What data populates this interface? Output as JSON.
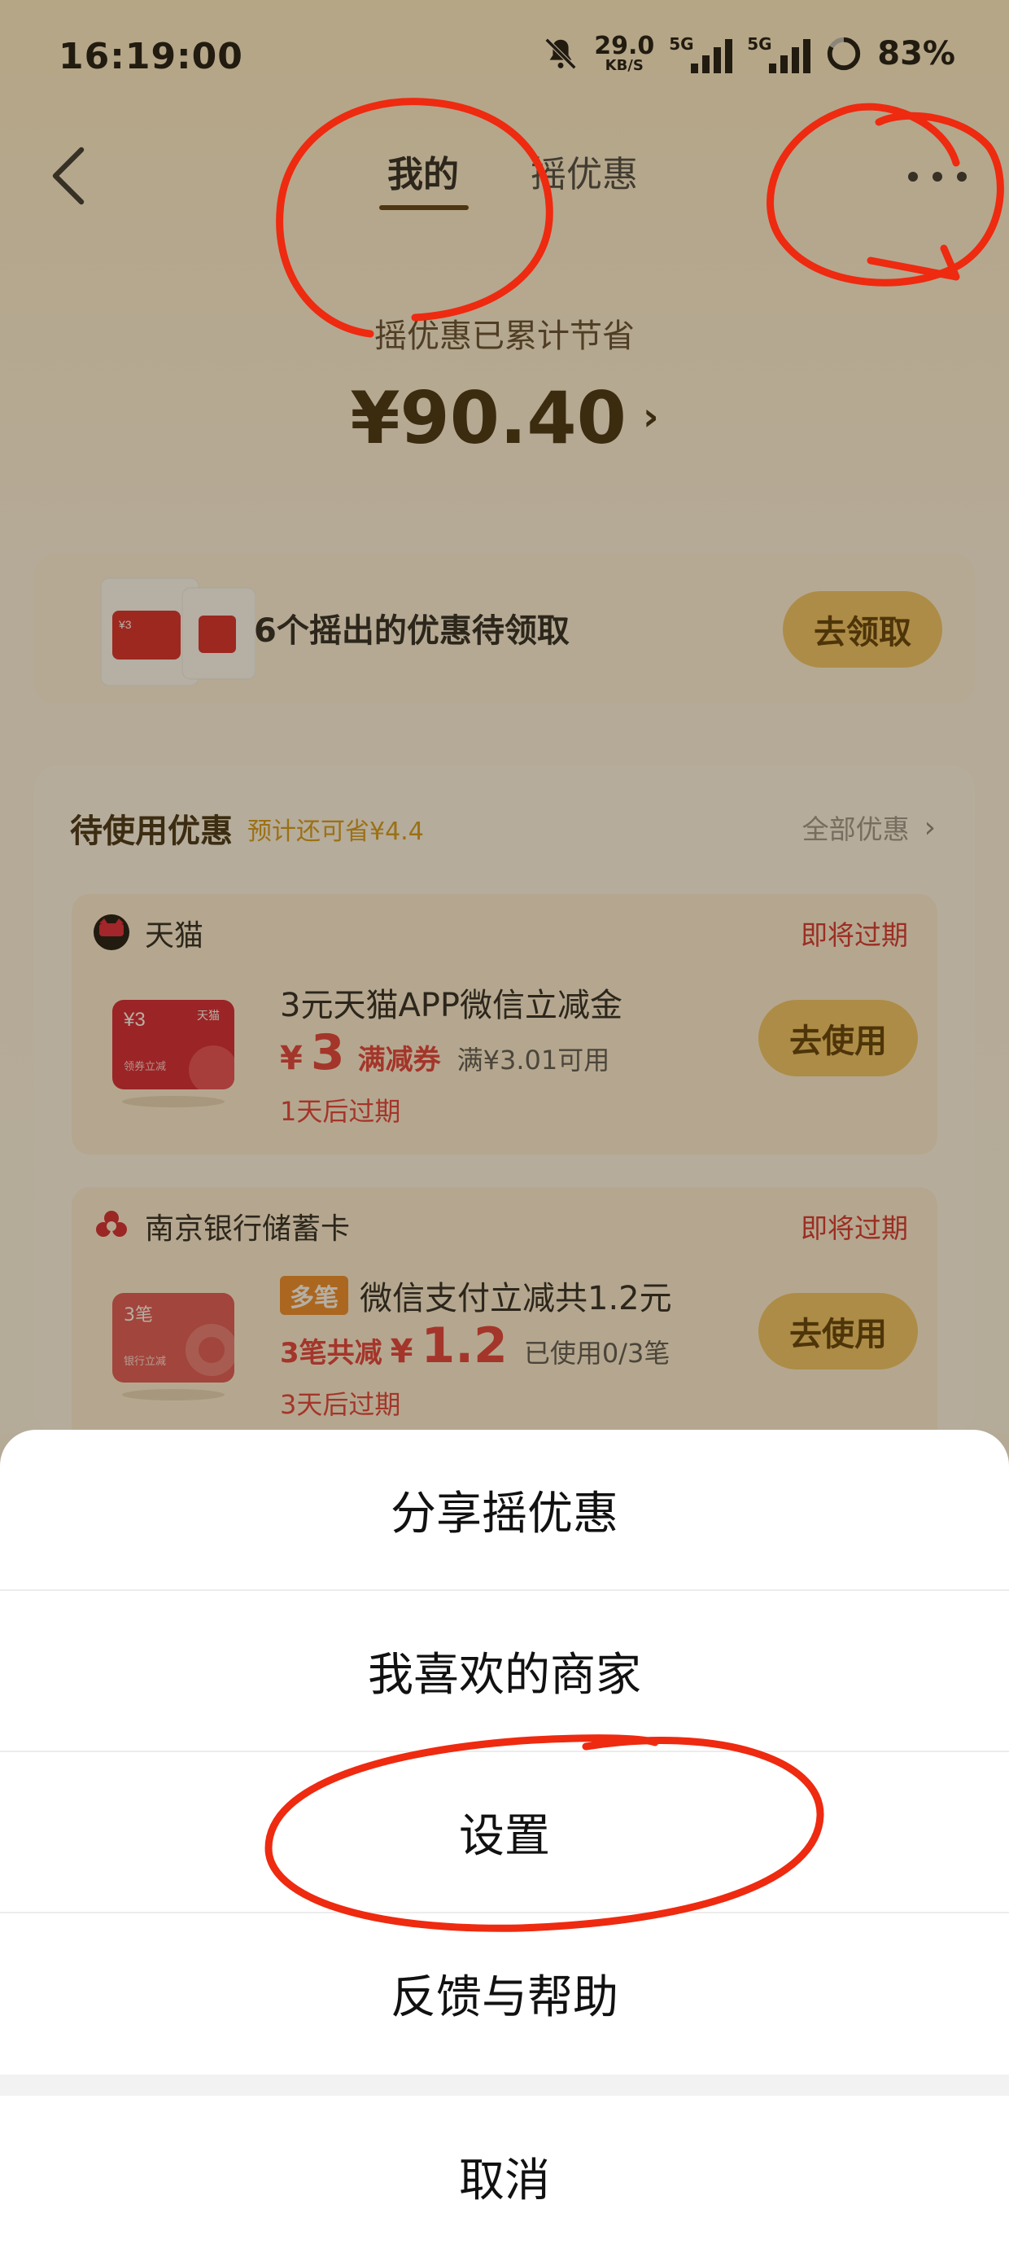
{
  "status_bar": {
    "time": "16:19:00",
    "net_speed": "29.0",
    "net_unit": "KB/S",
    "sim1_label": "5G",
    "sim2_label": "5G",
    "battery": "83%",
    "icons": [
      "mute-bell-icon",
      "signal-icon",
      "signal-icon",
      "battery-ring-icon"
    ]
  },
  "nav": {
    "tabs": [
      {
        "label": "我的",
        "selected": true
      },
      {
        "label": "摇优惠",
        "selected": false
      }
    ],
    "back_icon": "chevron-left-icon",
    "more_icon": "more-dots-icon"
  },
  "savings": {
    "label": "摇优惠已累计节省",
    "amount": "¥90.40",
    "arrow": "›"
  },
  "pending": {
    "text": "6个摇出的优惠待领取",
    "button": "去领取"
  },
  "coupons_panel": {
    "title": "待使用优惠",
    "subtitle": "预计还可省¥4.4",
    "view_all": "全部优惠",
    "view_all_chevron": "›",
    "coupons": [
      {
        "merchant": "天猫",
        "expire_tag": "即将过期",
        "title": "3元天猫APP微信立减金",
        "yen": "¥",
        "amount": "3",
        "type": "满减券",
        "condition": "满¥3.01可用",
        "expiry": "1天后过期",
        "button": "去使用",
        "card_text_amount": "¥3",
        "card_text_brand": "天猫",
        "card_text_sub": "领券立减"
      },
      {
        "merchant": "南京银行储蓄卡",
        "expire_tag": "即将过期",
        "badge": "多笔",
        "title": "微信支付立减共1.2元",
        "prefix": "3笔共减",
        "yen": "¥",
        "amount": "1.2",
        "condition": "已使用0/3笔",
        "expiry": "3天后过期",
        "button": "去使用",
        "card_text_amount": "3笔",
        "card_text_sub": "银行立减"
      }
    ]
  },
  "action_sheet": {
    "items": [
      "分享摇优惠",
      "我喜欢的商家",
      "设置",
      "反馈与帮助"
    ],
    "cancel": "取消"
  },
  "colors": {
    "accent_button": "#f3c769",
    "expire_red": "#d63030",
    "annotation_red": "#ee2a10",
    "overlay": "rgba(60,45,15,0.38)"
  }
}
